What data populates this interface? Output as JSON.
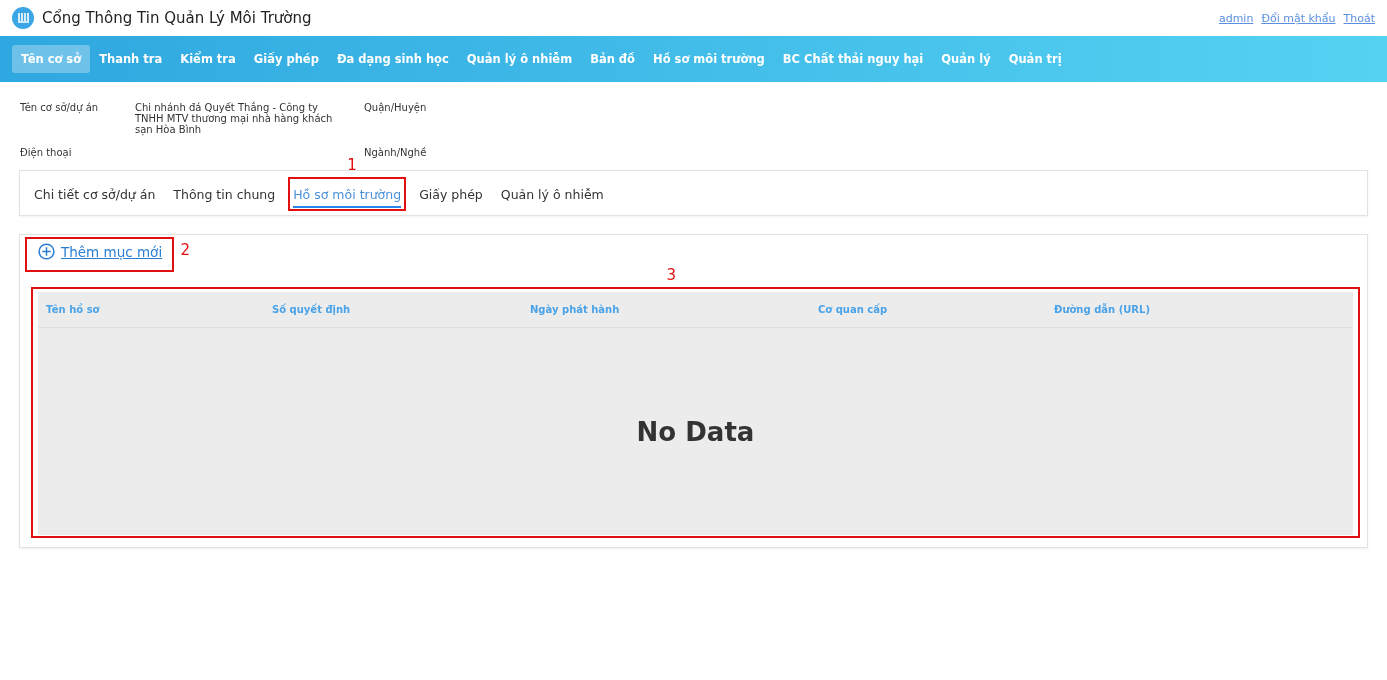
{
  "header": {
    "title": "Cổng Thông Tin Quản Lý Môi Trường",
    "links": [
      "admin",
      "Đổi mật khẩu",
      "Thoát"
    ]
  },
  "nav": [
    {
      "label": "Tên cơ sở",
      "selected": true
    },
    {
      "label": "Thanh tra",
      "selected": false
    },
    {
      "label": "Kiểm tra",
      "selected": false
    },
    {
      "label": "Giấy phép",
      "selected": false
    },
    {
      "label": "Đa dạng sinh học",
      "selected": false
    },
    {
      "label": "Quản lý ô nhiễm",
      "selected": false
    },
    {
      "label": "Bản đồ",
      "selected": false
    },
    {
      "label": "Hồ sơ môi trường",
      "selected": false
    },
    {
      "label": "BC Chất thải nguy hại",
      "selected": false
    },
    {
      "label": "Quản lý",
      "selected": false
    },
    {
      "label": "Quản trị",
      "selected": false
    }
  ],
  "info": [
    {
      "label": "Tên cơ sở/dự án",
      "value": "Chi nhánh đá Quyết Thắng - Công ty TNHH MTV thương mại nhà hàng khách sạn Hòa Bình",
      "label_2": "Quận/Huyện"
    },
    {
      "label": "Điện thoại",
      "label_2": "Ngành/Nghề"
    }
  ],
  "tabs": [
    {
      "label": "Chi tiết cơ sở/dự án",
      "selected": false
    },
    {
      "label": "Thông tin chung",
      "selected": false
    },
    {
      "label": "Hồ sơ môi trường",
      "selected": true
    },
    {
      "label": "Giấy phép",
      "selected": false
    },
    {
      "label": "Quản lý ô nhiễm",
      "selected": false
    }
  ],
  "add_button": {
    "label": "Thêm mục mới"
  },
  "table": {
    "columns": [
      "Tên hồ sơ",
      "Số quyết định",
      "Ngày phát hành",
      "Cơ quan cấp",
      "Đường dẫn (URL)"
    ],
    "empty_text": "No Data"
  },
  "annotations": [
    "1",
    "2",
    "3"
  ]
}
